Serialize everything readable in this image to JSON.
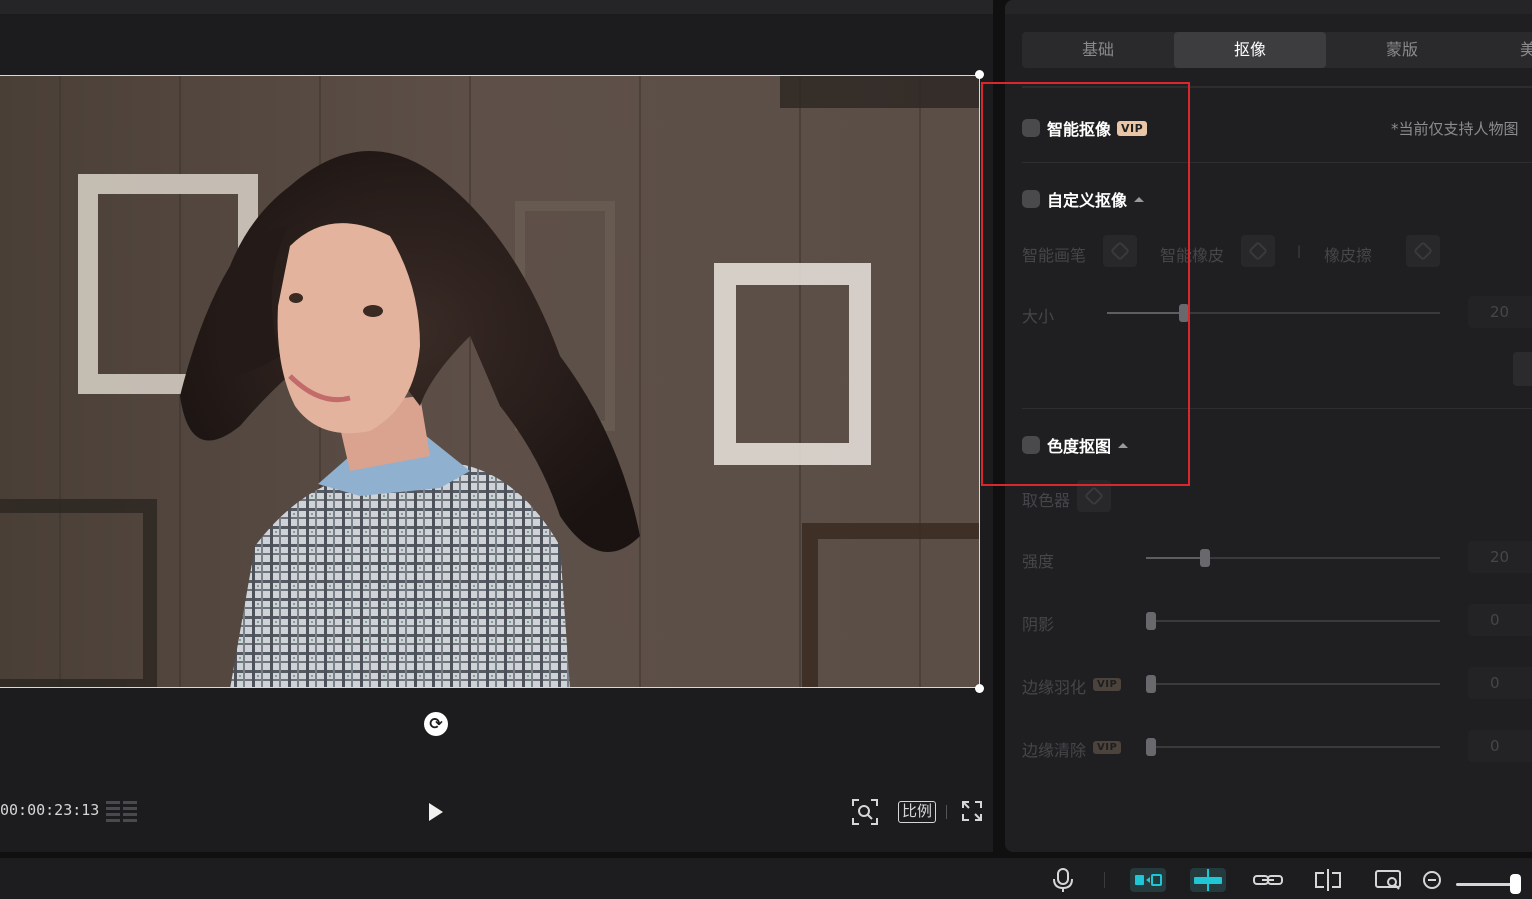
{
  "player": {
    "timecode": "00:00:23:13",
    "ratio_label": "比例",
    "rotate_icon": "rotate-icon",
    "play_icon": "play-icon"
  },
  "inspector": {
    "tabs": [
      {
        "label": "基础",
        "active": false
      },
      {
        "label": "抠像",
        "active": true
      },
      {
        "label": "蒙版",
        "active": false
      },
      {
        "label": "美",
        "active": false
      }
    ],
    "smart_cutout": {
      "label": "智能抠像",
      "vip": "VIP",
      "note": "*当前仅支持人物图",
      "checked": false
    },
    "custom_cutout": {
      "label": "自定义抠像",
      "checked": false,
      "tools": [
        "智能画笔",
        "智能橡皮",
        "橡皮擦"
      ],
      "size_label": "大小",
      "size_value": "20",
      "size_fraction": 0.23
    },
    "chroma_key": {
      "label": "色度抠图",
      "checked": false,
      "picker_label": "取色器",
      "sliders": [
        {
          "label": "强度",
          "value": "20",
          "fraction": 0.2,
          "vip": false
        },
        {
          "label": "阴影",
          "value": "0",
          "fraction": 0.0,
          "vip": false
        },
        {
          "label": "边缘羽化",
          "value": "0",
          "fraction": 0.0,
          "vip": true
        },
        {
          "label": "边缘清除",
          "value": "0",
          "fraction": 0.0,
          "vip": true
        }
      ]
    }
  },
  "colors": {
    "accent": "#1fc6d6",
    "highlight_box": "#d9272e",
    "vip_badge": "#e9c7a6",
    "panel_bg": "#1f1f21"
  },
  "bottom_toolbar": {
    "icons": [
      "microphone-icon",
      "link-left-icon",
      "auto-snap-icon",
      "link-icon",
      "split-icon",
      "preview-quality-icon",
      "zoom-out-icon"
    ],
    "zoom_level": 0.9
  }
}
